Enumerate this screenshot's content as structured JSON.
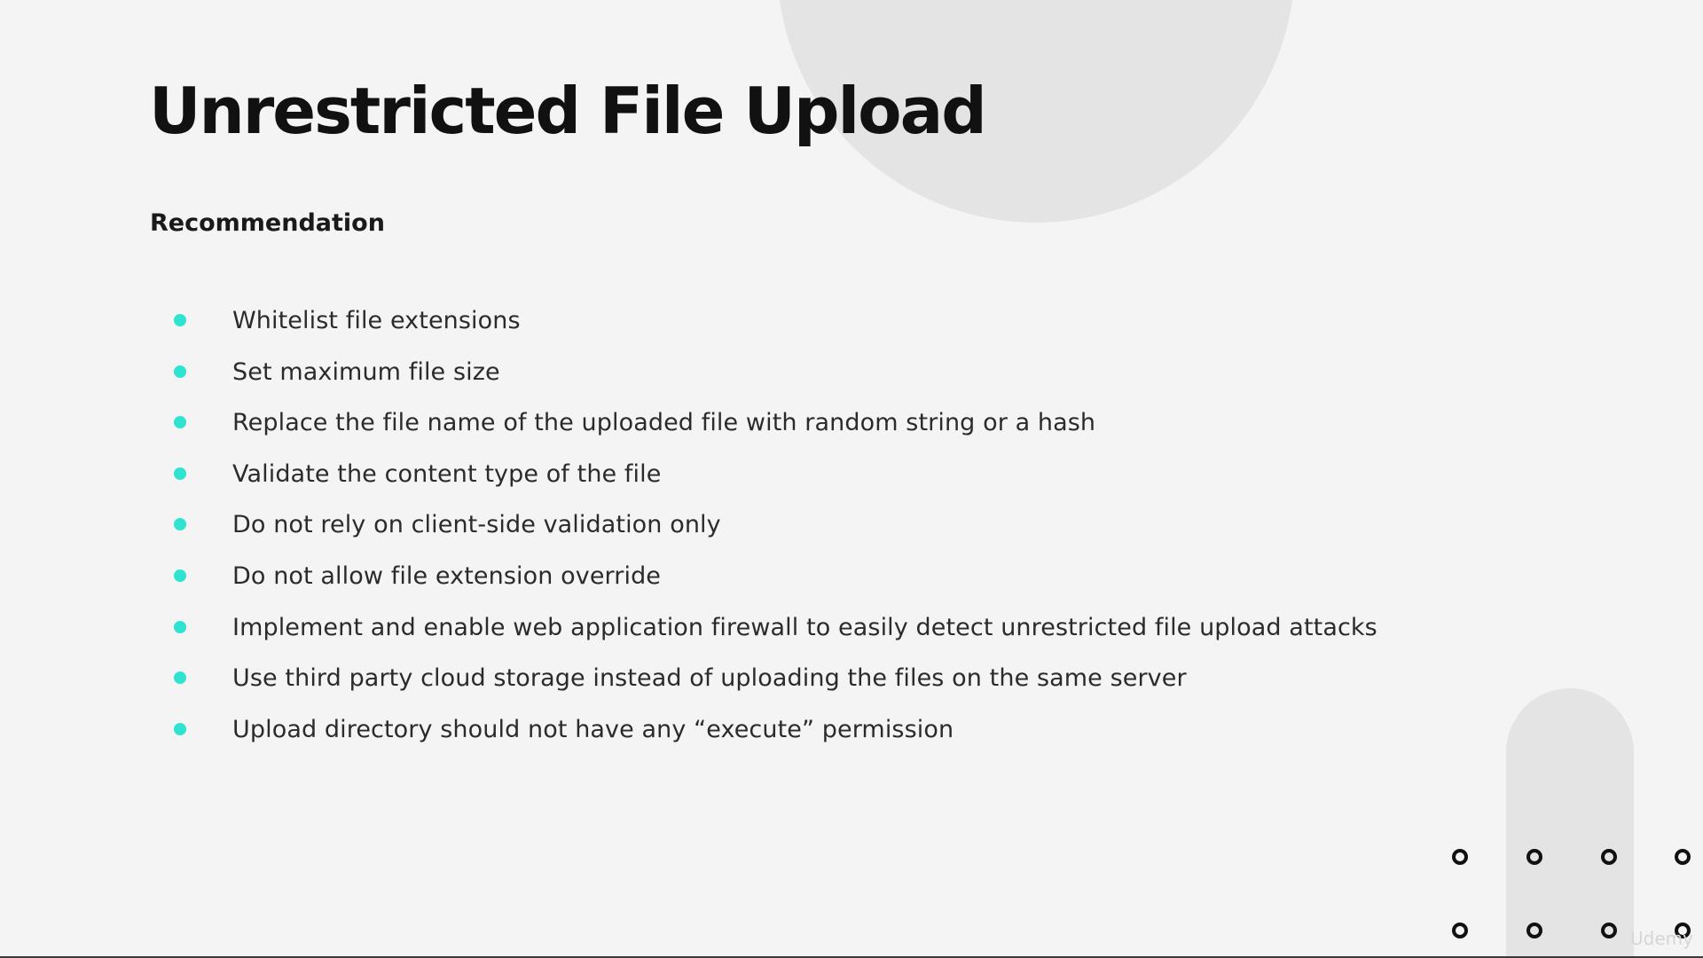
{
  "slide": {
    "title": "Unrestricted File Upload",
    "subtitle": "Recommendation",
    "bullets": [
      "Whitelist file extensions",
      "Set maximum file size",
      "Replace the file name of the uploaded file with random string or a hash",
      "Validate the content type of the file",
      "Do not rely on client-side validation only",
      "Do not allow file extension override",
      "Implement and enable web application firewall to easily detect unrestricted file upload attacks",
      "Use third party cloud storage instead of uploading the files on the same server",
      "Upload directory should not have any “execute” permission"
    ],
    "watermark": "Udemy"
  },
  "colors": {
    "background": "#f4f4f4",
    "decoration": "#e4e4e4",
    "bullet_accent": "#2ee3d0",
    "title": "#111111",
    "body_text": "#2b2b2b"
  },
  "icons": {
    "bullet": "teal-dot-icon",
    "decoration": "ring-dot-icon"
  }
}
